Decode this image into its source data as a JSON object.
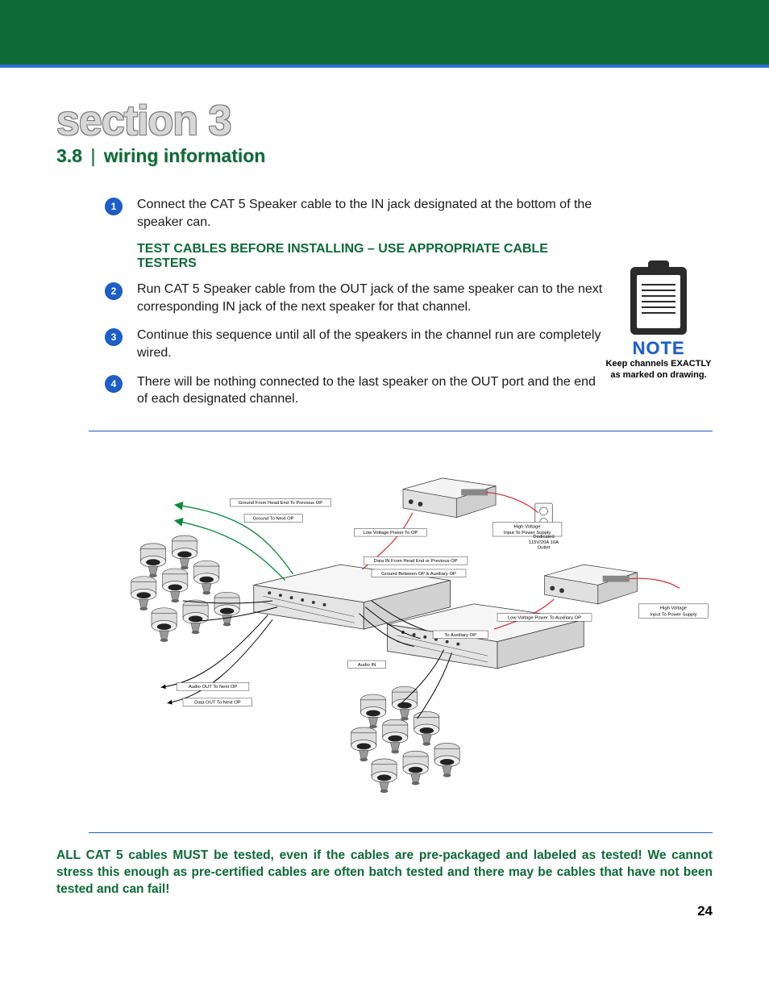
{
  "header": {
    "section_title": "section 3",
    "sub_number": "3.8",
    "sub_pipe": "|",
    "sub_text": "wiring information"
  },
  "steps": [
    {
      "n": "1",
      "text": "Connect the CAT 5 Speaker cable to the IN jack designated at the bottom of the speaker can."
    },
    {
      "n": "2",
      "text": "Run CAT 5 Speaker cable from the OUT jack of the same speaker can to the next corresponding IN jack of the next speaker for that channel."
    },
    {
      "n": "3",
      "text": "Continue this sequence until all of the speakers in the channel run are completely wired."
    },
    {
      "n": "4",
      "text": "There will be nothing connected to the last speaker on the OUT port and the end of each designated channel."
    }
  ],
  "callout": "TEST CABLES BEFORE INSTALLING – USE APPROPRIATE CABLE TESTERS",
  "note": {
    "word": "NOTE",
    "line1": "Keep channels EXACTLY",
    "line2": "as marked on drawing."
  },
  "diagram_labels": {
    "ground_from_head": "Ground From Head End To Previous OP",
    "ground_to_next": "Ground To Next OP",
    "low_voltage_to_op": "Low Voltage Power To OP",
    "data_in": "Data IN From Head End or Previous OP",
    "ground_between": "Ground Between OP & Auxiliary OP",
    "high_voltage_1": "High Voltage\nInput To Power Supply",
    "dedicated_outlet": "Dedicated\n115V/20A 10A\nOutlet",
    "low_voltage_aux": "Low Voltage Power To Auxiliary OP",
    "high_voltage_2": "High Voltage\nInput To Power Supply",
    "to_aux_op": "To Auxiliary OP",
    "audio_in": "Audio IN",
    "audio_out_next": "Audio OUT To Next OP",
    "data_out_next": "Data OUT To Next OP"
  },
  "warning": "ALL CAT 5 cables MUST be tested, even if the cables are pre-packaged and labeled as tested! We cannot stress this enough as pre-certified cables are often batch tested and there may be cables that have not been tested and can fail!",
  "page_number": "24"
}
